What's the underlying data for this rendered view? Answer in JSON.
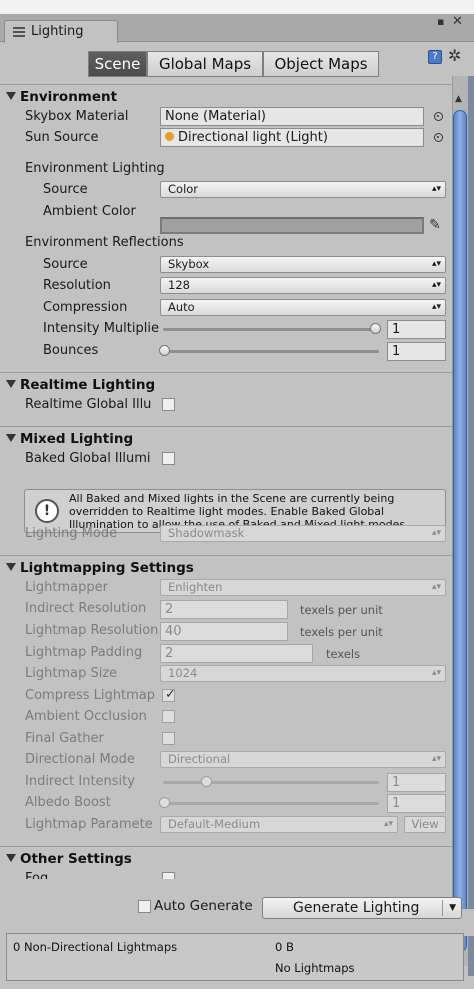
{
  "window": {
    "tab_title": "Lighting"
  },
  "tabs": [
    "Scene",
    "Global Maps",
    "Object Maps"
  ],
  "environment": {
    "header": "Environment",
    "skybox_material_label": "Skybox Material",
    "skybox_material_value": "None (Material)",
    "sun_source_label": "Sun Source",
    "sun_source_value": "Directional light (Light)",
    "env_lighting_header": "Environment Lighting",
    "source_label": "Source",
    "source_value": "Color",
    "ambient_color_label": "Ambient Color",
    "ambient_color": "#a0a0a0",
    "env_reflections_header": "Environment Reflections",
    "refl_source_label": "Source",
    "refl_source_value": "Skybox",
    "resolution_label": "Resolution",
    "resolution_value": "128",
    "compression_label": "Compression",
    "compression_value": "Auto",
    "intensity_label": "Intensity Multiplie",
    "intensity_value": "1",
    "intensity_level": 1.0,
    "bounces_label": "Bounces",
    "bounces_value": "1",
    "bounces_level": 0.0
  },
  "realtime": {
    "header": "Realtime Lighting",
    "rtgi_label": "Realtime Global Illu",
    "rtgi_checked": false
  },
  "mixed": {
    "header": "Mixed Lighting",
    "baked_gi_label": "Baked Global Illumi",
    "baked_gi_checked": false,
    "info_message": "All Baked and Mixed lights in the Scene are currently being overridden to Realtime light modes. Enable Baked Global Illumination to allow the use of Baked and Mixed light modes.",
    "lighting_mode_label": "Lighting Mode",
    "lighting_mode_value": "Shadowmask"
  },
  "lightmapping": {
    "header": "Lightmapping Settings",
    "lightmapper_label": "Lightmapper",
    "lightmapper_value": "Enlighten",
    "indirect_res_label": "Indirect Resolution",
    "indirect_res_value": "2",
    "indirect_res_unit": "texels per unit",
    "lightmap_res_label": "Lightmap Resolution",
    "lightmap_res_value": "40",
    "lightmap_res_unit": "texels per unit",
    "padding_label": "Lightmap Padding",
    "padding_value": "2",
    "padding_unit": "texels",
    "size_label": "Lightmap Size",
    "size_value": "1024",
    "compress_label": "Compress Lightmap",
    "compress_checked": true,
    "ao_label": "Ambient Occlusion",
    "ao_checked": false,
    "final_gather_label": "Final Gather",
    "final_gather_checked": false,
    "directional_mode_label": "Directional Mode",
    "directional_mode_value": "Directional",
    "indirect_intensity_label": "Indirect Intensity",
    "indirect_intensity_value": "1",
    "indirect_intensity_level": 0.2,
    "albedo_boost_label": "Albedo Boost",
    "albedo_boost_value": "1",
    "albedo_boost_level": 0.0,
    "params_label": "Lightmap Paramete",
    "params_value": "Default-Medium",
    "view_label": "View"
  },
  "other": {
    "header": "Other Settings",
    "fog_label": "Fog",
    "fog_checked": false
  },
  "bottom": {
    "auto_generate_label": "Auto Generate",
    "auto_generate_checked": false,
    "generate_label": "Generate Lighting"
  },
  "stats": {
    "lightmaps_label": "0 Non-Directional Lightmaps",
    "size": "0 B",
    "status": "No Lightmaps"
  }
}
